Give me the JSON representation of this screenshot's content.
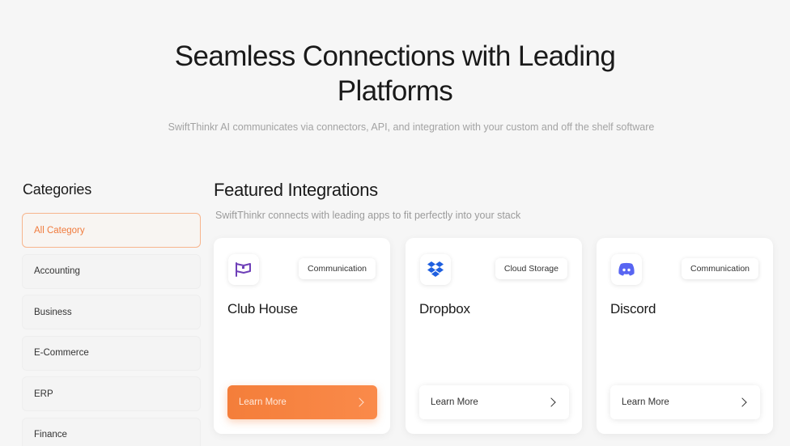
{
  "hero": {
    "title_line1": "Seamless Connections with Leading",
    "title_line2": "Platforms",
    "subtitle": "SwiftThinkr AI communicates via connectors, API, and integration with your custom and off the shelf software"
  },
  "categories": {
    "heading": "Categories",
    "items": [
      {
        "label": "All Category",
        "active": true
      },
      {
        "label": "Accounting"
      },
      {
        "label": "Business"
      },
      {
        "label": "E-Commerce"
      },
      {
        "label": "ERP"
      },
      {
        "label": "Finance"
      }
    ]
  },
  "featured": {
    "heading": "Featured Integrations",
    "subtitle": "SwiftThinkr connects with leading apps to fit perfectly into your stack",
    "cards": [
      {
        "name": "Club House",
        "tag": "Communication",
        "button": "Learn More",
        "icon": "clubhouse-flag-icon"
      },
      {
        "name": "Dropbox",
        "tag": "Cloud Storage",
        "button": "Learn More",
        "icon": "dropbox-icon"
      },
      {
        "name": "Discord",
        "tag": "Communication",
        "button": "Learn More",
        "icon": "discord-icon"
      }
    ]
  },
  "colors": {
    "accent": "#f47e3a",
    "clubhouse_icon": "#6e3fb8",
    "dropbox_icon": "#1e5fe0",
    "discord_icon": "#5865f2"
  }
}
